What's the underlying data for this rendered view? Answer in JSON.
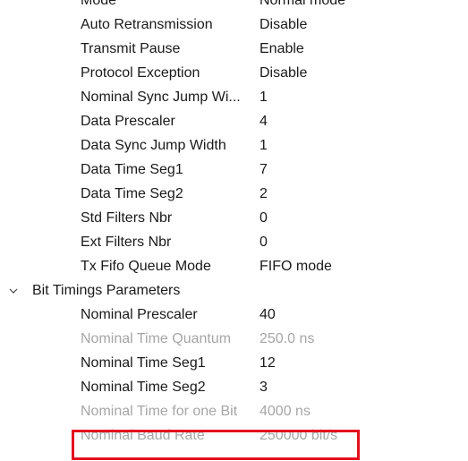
{
  "params": [
    {
      "name": "Mode",
      "value": "Normal mode",
      "disabled": false
    },
    {
      "name": "Auto Retransmission",
      "value": "Disable",
      "disabled": false
    },
    {
      "name": "Transmit Pause",
      "value": "Enable",
      "disabled": false
    },
    {
      "name": "Protocol Exception",
      "value": "Disable",
      "disabled": false
    },
    {
      "name": "Nominal Sync Jump Wi...",
      "value": "1",
      "disabled": false
    },
    {
      "name": "Data Prescaler",
      "value": "4",
      "disabled": false
    },
    {
      "name": "Data Sync Jump Width",
      "value": "1",
      "disabled": false
    },
    {
      "name": "Data Time Seg1",
      "value": "7",
      "disabled": false
    },
    {
      "name": "Data Time Seg2",
      "value": "2",
      "disabled": false
    },
    {
      "name": "Std Filters Nbr",
      "value": "0",
      "disabled": false
    },
    {
      "name": "Ext Filters Nbr",
      "value": "0",
      "disabled": false
    },
    {
      "name": "Tx Fifo Queue Mode",
      "value": "FIFO mode",
      "disabled": false
    }
  ],
  "bit_timings": {
    "label": "Bit Timings Parameters",
    "expanded_icon": "chevron-down-icon",
    "params": [
      {
        "name": "Nominal Prescaler",
        "value": "40",
        "disabled": false
      },
      {
        "name": "Nominal Time Quantum",
        "value": "250.0 ns",
        "disabled": true
      },
      {
        "name": "Nominal Time Seg1",
        "value": "12",
        "disabled": false
      },
      {
        "name": "Nominal Time Seg2",
        "value": "3",
        "disabled": false
      },
      {
        "name": "Nominal Time for one Bit",
        "value": "4000 ns",
        "disabled": true
      },
      {
        "name": "Nominal Baud Rate",
        "value": "250000 bit/s",
        "disabled": true
      }
    ]
  },
  "colors": {
    "text": "#1a1a1a",
    "disabled_text": "#a6a6a6",
    "highlight": "#e3101c"
  }
}
